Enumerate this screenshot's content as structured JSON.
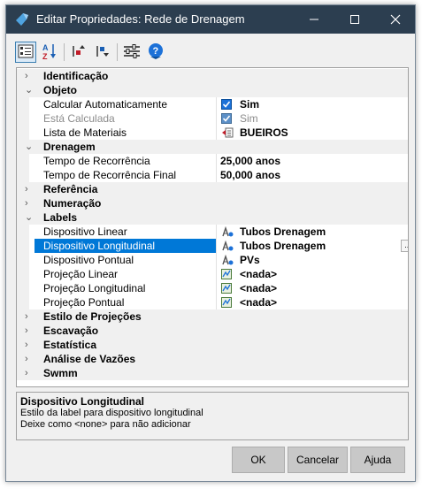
{
  "window": {
    "title": "Editar Propriedades: Rede de Drenagem",
    "controls": {
      "minimize": "—",
      "maximize": "☐",
      "close": "✕"
    }
  },
  "toolbar": {
    "items": [
      {
        "icon": "categorized-view-icon",
        "active": true
      },
      {
        "icon": "alphabetical-sort-icon",
        "active": false
      },
      {
        "icon": "collapse-all-icon",
        "active": false
      },
      {
        "icon": "expand-all-icon",
        "active": false
      },
      {
        "icon": "settings-sliders-icon",
        "active": false
      },
      {
        "icon": "help-icon",
        "active": false
      }
    ]
  },
  "grid": {
    "categories": {
      "identificacao": "Identificação",
      "objeto": "Objeto",
      "drenagem": "Drenagem",
      "referencia": "Referência",
      "numeracao": "Numeração",
      "labels": "Labels",
      "estilo_projecoes": "Estilo de Projeções",
      "escavacao": "Escavação",
      "estatistica": "Estatística",
      "analise_vazoes": "Análise de Vazões",
      "swmm": "Swmm"
    },
    "props": {
      "calc_auto": {
        "name": "Calcular Automaticamente",
        "value": "Sim"
      },
      "esta_calculada": {
        "name": "Está Calculada",
        "value": "Sim"
      },
      "lista_materiais": {
        "name": "Lista de Materiais",
        "value": "BUEIROS"
      },
      "tempo_recorrencia": {
        "name": "Tempo de Recorrência",
        "value": "25,000 anos"
      },
      "tempo_recorrencia_final": {
        "name": "Tempo de Recorrência Final",
        "value": "50,000 anos"
      },
      "disp_linear": {
        "name": "Dispositivo Linear",
        "value": "Tubos Drenagem"
      },
      "disp_longitudinal": {
        "name": "Dispositivo Longitudinal",
        "value": "Tubos Drenagem",
        "button": "..."
      },
      "disp_pontual": {
        "name": "Dispositivo Pontual",
        "value": "PVs"
      },
      "proj_linear": {
        "name": "Projeção Linear",
        "value": "<nada>"
      },
      "proj_longitudinal": {
        "name": "Projeção Longitudinal",
        "value": "<nada>"
      },
      "proj_pontual": {
        "name": "Projeção Pontual",
        "value": "<nada>"
      }
    }
  },
  "description": {
    "title": "Dispositivo Longitudinal",
    "line1": "Estilo da label para dispositivo longitudinal",
    "line2": "Deixe como <none> para não adicionar"
  },
  "buttons": {
    "ok": "OK",
    "cancel": "Cancelar",
    "help": "Ajuda"
  },
  "colors": {
    "titlebar": "#2c3e50",
    "selection": "#0078d7",
    "category_bg": "#f0f0f0"
  }
}
